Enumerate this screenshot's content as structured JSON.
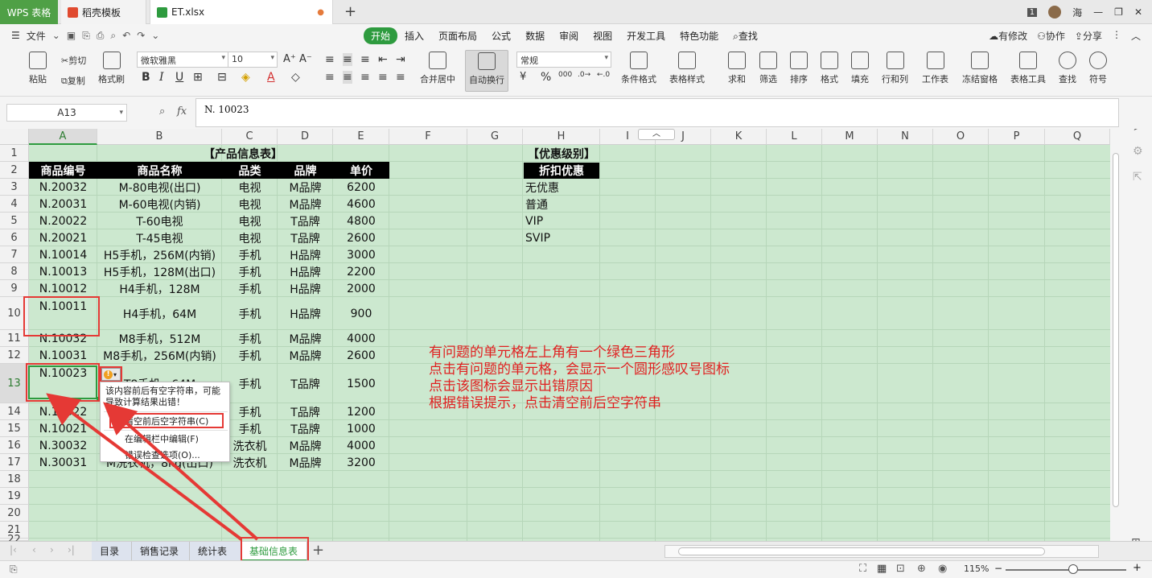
{
  "tabs": {
    "wps": "WPS 表格",
    "daoke": "稻壳模板",
    "file": "ET.xlsx",
    "badge": "1",
    "user": "海"
  },
  "menu": {
    "file": "文件",
    "tabs": [
      "开始",
      "插入",
      "页面布局",
      "公式",
      "数据",
      "审阅",
      "视图",
      "开发工具",
      "特色功能"
    ],
    "search": "查找",
    "right": [
      "有修改",
      "协作",
      "分享"
    ]
  },
  "ribbon": {
    "paste": "粘贴",
    "cut": "剪切",
    "copy": "复制",
    "format_painter": "格式刷",
    "font_name": "微软雅黑",
    "font_size": "10",
    "merge_center": "合并居中",
    "auto_wrap": "自动换行",
    "number_format": "常规",
    "cond_format": "条件格式",
    "table_style": "表格样式",
    "sum": "求和",
    "filter": "筛选",
    "sort": "排序",
    "format": "格式",
    "fill": "填充",
    "rowcol": "行和列",
    "worksheet": "工作表",
    "freeze": "冻结窗格",
    "table_tools": "表格工具",
    "find": "查找",
    "symbol": "符号",
    "bold": "B",
    "italic": "I",
    "underline": "U",
    "font_color": "A",
    "percent": "%",
    "thousands": "000"
  },
  "formula": {
    "namebox": "A13",
    "fx": "fx",
    "value": "N. 10023"
  },
  "columns": [
    "A",
    "B",
    "C",
    "D",
    "E",
    "F",
    "G",
    "H",
    "I",
    "J",
    "K",
    "L",
    "M",
    "N",
    "O",
    "P",
    "Q"
  ],
  "rows": [
    "1",
    "2",
    "3",
    "4",
    "5",
    "6",
    "7",
    "8",
    "9",
    "10",
    "11",
    "12",
    "13",
    "14",
    "15",
    "16",
    "17",
    "18",
    "19",
    "20",
    "21",
    "22"
  ],
  "table": {
    "title": "【产品信息表】",
    "headers": [
      "商品编号",
      "商品名称",
      "品类",
      "品牌",
      "单价"
    ],
    "rows": [
      [
        "N.20032",
        "M-80电视(出口)",
        "电视",
        "M品牌",
        "6200"
      ],
      [
        "N.20031",
        "M-60电视(内销)",
        "电视",
        "M品牌",
        "4600"
      ],
      [
        "N.20022",
        "T-60电视",
        "电视",
        "T品牌",
        "4800"
      ],
      [
        "N.20021",
        "T-45电视",
        "电视",
        "T品牌",
        "2600"
      ],
      [
        "N.10014",
        "H5手机，256M(内销)",
        "手机",
        "H品牌",
        "3000"
      ],
      [
        "N.10013",
        "H5手机，128M(出口)",
        "手机",
        "H品牌",
        "2200"
      ],
      [
        "N.10012",
        "H4手机，128M",
        "手机",
        "H品牌",
        "2000"
      ],
      [
        "N.10011",
        "H4手机，64M",
        "手机",
        "H品牌",
        "900"
      ],
      [
        "N.10032",
        "M8手机，512M",
        "手机",
        "M品牌",
        "4000"
      ],
      [
        "N.10031",
        "M8手机，256M(内销)",
        "手机",
        "M品牌",
        "2600"
      ],
      [
        "N.10023",
        "T8手机，64M",
        "手机",
        "T品牌",
        "1500"
      ],
      [
        "N.10022",
        "",
        "手机",
        "T品牌",
        "1200"
      ],
      [
        "N.10021",
        "",
        "手机",
        "T品牌",
        "1000"
      ],
      [
        "N.30032",
        "",
        "洗衣机",
        "M品牌",
        "4000"
      ],
      [
        "N.30031",
        "M洗衣机，8kg(出口)",
        "洗衣机",
        "M品牌",
        "3200"
      ]
    ]
  },
  "discount": {
    "title": "【优惠级别】",
    "header": "折扣优惠",
    "items": [
      "无优惠",
      "普通",
      "VIP",
      "SVIP"
    ]
  },
  "context_menu": {
    "message": "该内容前后有空字符串，可能导致计算结果出错！",
    "items": [
      "清空前后空字符串(C)",
      "在编辑栏中编辑(F)",
      "错误检查选项(O)..."
    ]
  },
  "annotation": [
    "有问题的单元格左上角有一个绿色三角形",
    "点击有问题的单元格，会显示一个圆形感叹号图标",
    "点击该图标会显示出错原因",
    "根据错误提示，点击清空前后空字符串"
  ],
  "sheet_tabs": [
    "目录",
    "销售记录",
    "统计表",
    "基础信息表"
  ],
  "status": {
    "zoom": "115%"
  },
  "colors": {
    "accent": "#2e9b3f",
    "sheet_bg": "#cce8cf",
    "annotation": "#e02020"
  }
}
